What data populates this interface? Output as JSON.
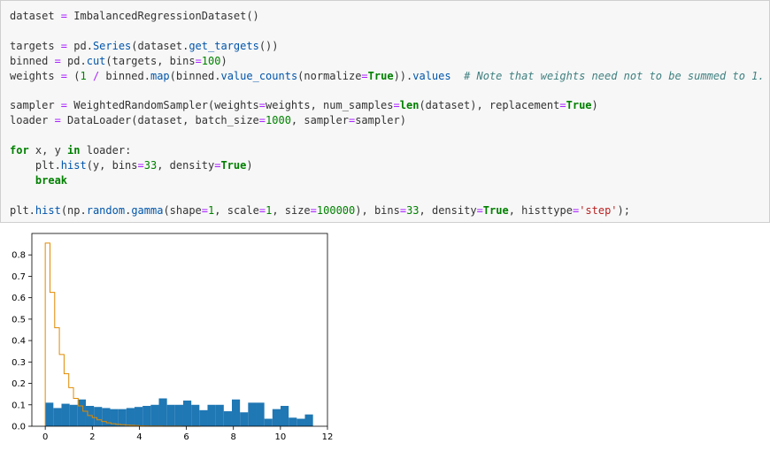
{
  "code_lines": [
    [
      [
        "t",
        "dataset "
      ],
      [
        "op",
        "="
      ],
      [
        "t",
        " ImbalancedRegressionDataset()"
      ]
    ],
    [],
    [
      [
        "t",
        "targets "
      ],
      [
        "op",
        "="
      ],
      [
        "t",
        " pd."
      ],
      [
        "fn",
        "Series"
      ],
      [
        "t",
        "(dataset."
      ],
      [
        "fn",
        "get_targets"
      ],
      [
        "t",
        "())"
      ]
    ],
    [
      [
        "t",
        "binned "
      ],
      [
        "op",
        "="
      ],
      [
        "t",
        " pd."
      ],
      [
        "fn",
        "cut"
      ],
      [
        "t",
        "(targets, bins"
      ],
      [
        "op",
        "="
      ],
      [
        "num",
        "100"
      ],
      [
        "t",
        ")"
      ]
    ],
    [
      [
        "t",
        "weights "
      ],
      [
        "op",
        "="
      ],
      [
        "t",
        " ("
      ],
      [
        "num",
        "1"
      ],
      [
        "t",
        " "
      ],
      [
        "op",
        "/"
      ],
      [
        "t",
        " binned."
      ],
      [
        "fn",
        "map"
      ],
      [
        "t",
        "(binned."
      ],
      [
        "fn",
        "value_counts"
      ],
      [
        "t",
        "(normalize"
      ],
      [
        "op",
        "="
      ],
      [
        "kw",
        "True"
      ],
      [
        "t",
        "))."
      ],
      [
        "fn",
        "values"
      ],
      [
        "t",
        "  "
      ],
      [
        "cm",
        "# Note that weights need not to be summed to 1."
      ]
    ],
    [],
    [
      [
        "t",
        "sampler "
      ],
      [
        "op",
        "="
      ],
      [
        "t",
        " WeightedRandomSampler(weights"
      ],
      [
        "op",
        "="
      ],
      [
        "t",
        "weights, num_samples"
      ],
      [
        "op",
        "="
      ],
      [
        "kw",
        "len"
      ],
      [
        "t",
        "(dataset), replacement"
      ],
      [
        "op",
        "="
      ],
      [
        "kw",
        "True"
      ],
      [
        "t",
        ")"
      ]
    ],
    [
      [
        "t",
        "loader "
      ],
      [
        "op",
        "="
      ],
      [
        "t",
        " DataLoader(dataset, batch_size"
      ],
      [
        "op",
        "="
      ],
      [
        "num",
        "1000"
      ],
      [
        "t",
        ", sampler"
      ],
      [
        "op",
        "="
      ],
      [
        "t",
        "sampler)"
      ]
    ],
    [],
    [
      [
        "kw",
        "for"
      ],
      [
        "t",
        " x, y "
      ],
      [
        "kw",
        "in"
      ],
      [
        "t",
        " loader:"
      ]
    ],
    [
      [
        "t",
        "    plt."
      ],
      [
        "fn",
        "hist"
      ],
      [
        "t",
        "(y, bins"
      ],
      [
        "op",
        "="
      ],
      [
        "num",
        "33"
      ],
      [
        "t",
        ", density"
      ],
      [
        "op",
        "="
      ],
      [
        "kw",
        "True"
      ],
      [
        "t",
        ")"
      ]
    ],
    [
      [
        "t",
        "    "
      ],
      [
        "kw",
        "break"
      ]
    ],
    [],
    [
      [
        "t",
        "plt."
      ],
      [
        "fn",
        "hist"
      ],
      [
        "t",
        "(np."
      ],
      [
        "fn",
        "random"
      ],
      [
        "t",
        "."
      ],
      [
        "fn",
        "gamma"
      ],
      [
        "t",
        "(shape"
      ],
      [
        "op",
        "="
      ],
      [
        "num",
        "1"
      ],
      [
        "t",
        ", scale"
      ],
      [
        "op",
        "="
      ],
      [
        "num",
        "1"
      ],
      [
        "t",
        ", size"
      ],
      [
        "op",
        "="
      ],
      [
        "num",
        "100000"
      ],
      [
        "t",
        "), bins"
      ],
      [
        "op",
        "="
      ],
      [
        "num",
        "33"
      ],
      [
        "t",
        ", density"
      ],
      [
        "op",
        "="
      ],
      [
        "kw",
        "True"
      ],
      [
        "t",
        ", histtype"
      ],
      [
        "op",
        "="
      ],
      [
        "str",
        "'step'"
      ],
      [
        "t",
        ");"
      ]
    ]
  ],
  "chart_data": {
    "type": "bar",
    "xlim": [
      -0.57,
      12.0
    ],
    "ylim": [
      0,
      0.9
    ],
    "xticks": [
      "0",
      "2",
      "4",
      "6",
      "8",
      "10",
      "12"
    ],
    "xtick_values": [
      0,
      2,
      4,
      6,
      8,
      10,
      12
    ],
    "yticks": [
      "0.0",
      "0.1",
      "0.2",
      "0.3",
      "0.4",
      "0.5",
      "0.6",
      "0.7",
      "0.8"
    ],
    "ytick_values": [
      0,
      0.1,
      0.2,
      0.3,
      0.4,
      0.5,
      0.6,
      0.7,
      0.8
    ],
    "grid": false,
    "series": [
      {
        "kind": "bar",
        "color": "#1f77b4",
        "x_start": 0.0,
        "bin_width": 0.345,
        "values": [
          0.11,
          0.085,
          0.105,
          0.1,
          0.125,
          0.095,
          0.09,
          0.085,
          0.08,
          0.08,
          0.085,
          0.09,
          0.095,
          0.1,
          0.13,
          0.1,
          0.1,
          0.12,
          0.1,
          0.075,
          0.1,
          0.1,
          0.07,
          0.125,
          0.065,
          0.11,
          0.11,
          0.035,
          0.08,
          0.095,
          0.04,
          0.035,
          0.055
        ]
      },
      {
        "kind": "step",
        "color": "#e08a00",
        "x_start": 0.0,
        "bin_width": 0.2,
        "values": [
          0.855,
          0.625,
          0.46,
          0.335,
          0.245,
          0.18,
          0.13,
          0.095,
          0.07,
          0.05,
          0.04,
          0.03,
          0.022,
          0.016,
          0.012,
          0.009,
          0.007,
          0.005,
          0.004,
          0.003,
          0.002,
          0.0016,
          0.0012,
          0.001,
          0.0008,
          0.0006,
          0.0005,
          0.0004,
          0.0003,
          0.0002,
          0.0002,
          0.0001,
          0.0001
        ]
      }
    ]
  }
}
